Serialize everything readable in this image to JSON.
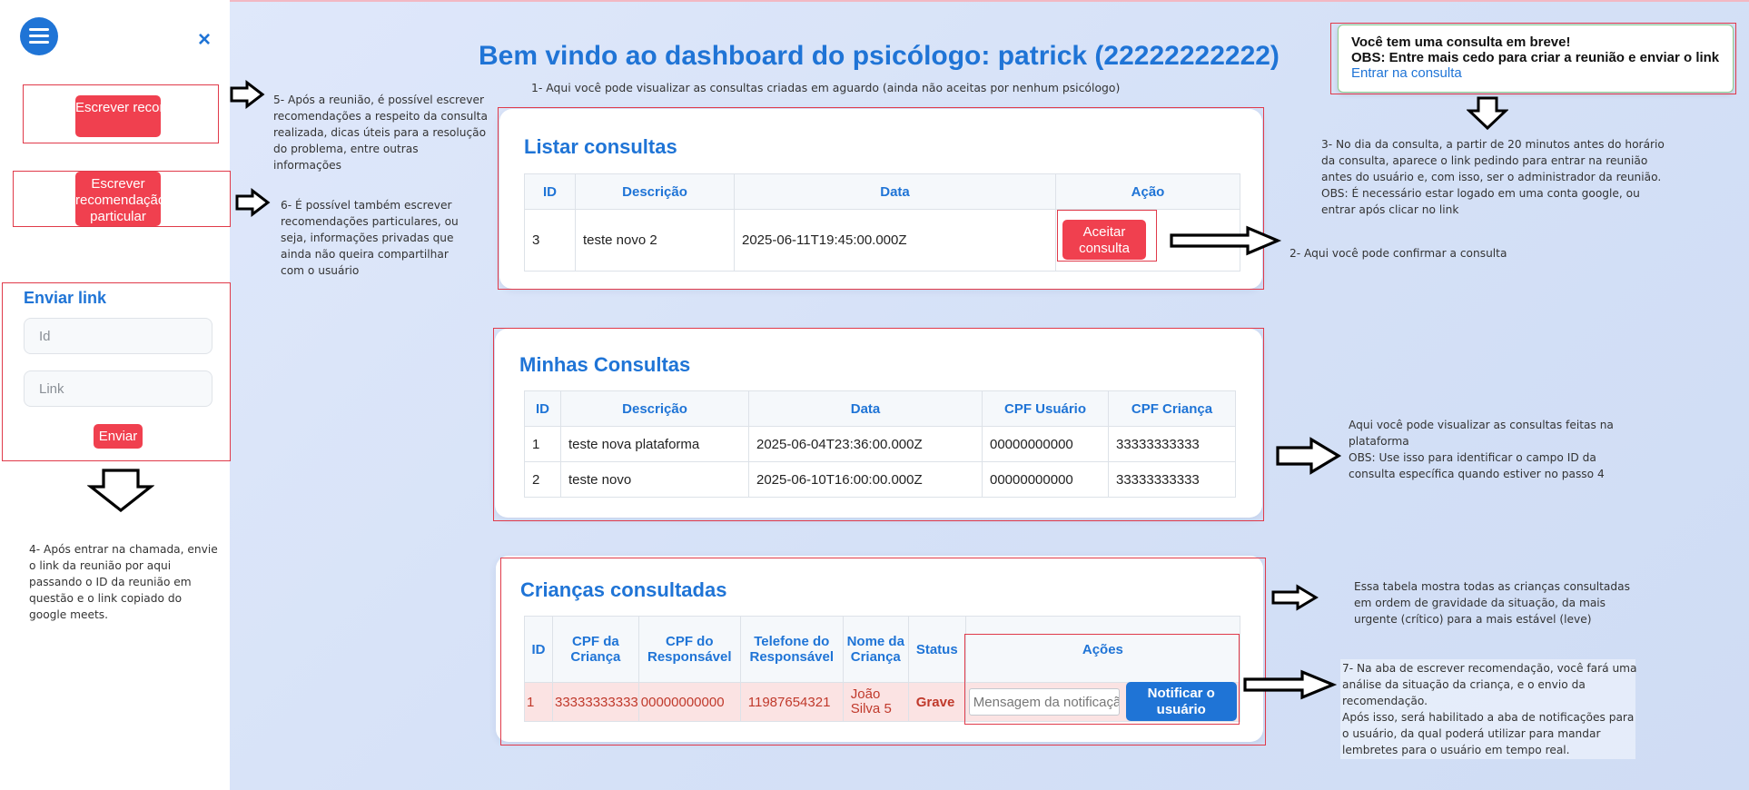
{
  "sidebar": {
    "write_recommendation_label": "Escrever recomendação",
    "write_private_recommendation_label": "Escrever recomendação particular",
    "send_link": {
      "title": "Enviar link",
      "id_placeholder": "Id",
      "link_placeholder": "Link",
      "submit_label": "Enviar"
    }
  },
  "header": {
    "title": "Bem vindo ao dashboard do psicólogo: patrick (22222222222)"
  },
  "notification": {
    "line1": "Você tem uma consulta em breve!",
    "line2": "OBS: Entre mais cedo para criar a reunião e enviar o link",
    "link_label": "Entrar na consulta"
  },
  "annotations": {
    "step1": "1- Aqui você pode visualizar as consultas criadas em aguardo (ainda não aceitas por nenhum psicólogo)",
    "step2": "2- Aqui você pode confirmar a consulta",
    "step3": [
      "3- No dia da consulta, a partir de 20 minutos antes do horário",
      "da consulta, aparece o link pedindo para entrar na reunião",
      "antes do usuário e, com isso, ser o administrador da reunião.",
      "OBS: É necessário estar logado em uma conta google, ou",
      "entrar após clicar no link"
    ],
    "step4": [
      "4- Após entrar na chamada, envie",
      "o link da reunião por aqui",
      "passando o ID da reunião em",
      "questão e o link copiado do",
      "google meets."
    ],
    "step5": [
      "5- Após a reunião, é possível escrever",
      "recomendações a respeito da consulta",
      "realizada, dicas úteis para a resolução",
      "do problema, entre outras",
      "informações"
    ],
    "step6": [
      "6- É possível também escrever",
      "recomendações particulares, ou",
      "seja, informações privadas que",
      "ainda não queira compartilhar",
      "com o usuário"
    ],
    "step7": [
      "7- Na aba de escrever recomendação, você fará uma",
      "análise da situação da criança, e o envio da",
      "recomendação.",
      "Após isso, será habilitado a aba de notificações para",
      "o usuário, da qual poderá utilizar para mandar",
      "lembretes para o usuário em tempo real."
    ],
    "my_consults": [
      "Aqui você pode visualizar as consultas feitas na",
      "plataforma",
      "OBS: Use isso para identificar o campo ID da",
      "consulta específica quando estiver no passo 4"
    ],
    "children": [
      "Essa tabela mostra todas as crianças consultadas",
      "em ordem de gravidade da situação, da mais",
      "urgente (crítico) para a mais estável (leve)"
    ]
  },
  "pending_consults": {
    "title": "Listar consultas",
    "headers": [
      "ID",
      "Descrição",
      "Data",
      "Ação"
    ],
    "rows": [
      {
        "id": "3",
        "description": "teste novo 2",
        "date": "2025-06-11T19:45:00.000Z",
        "action": "Aceitar consulta"
      }
    ]
  },
  "my_consults": {
    "title": "Minhas Consultas",
    "headers": [
      "ID",
      "Descrição",
      "Data",
      "CPF Usuário",
      "CPF Criança"
    ],
    "rows": [
      {
        "id": "1",
        "description": "teste nova plataforma",
        "date": "2025-06-04T23:36:00.000Z",
        "cpf_user": "00000000000",
        "cpf_child": "33333333333"
      },
      {
        "id": "2",
        "description": "teste novo",
        "date": "2025-06-10T16:00:00.000Z",
        "cpf_user": "00000000000",
        "cpf_child": "33333333333"
      }
    ]
  },
  "children": {
    "title": "Crianças consultadas",
    "headers": [
      "ID",
      "CPF da Criança",
      "CPF do Responsável",
      "Telefone do Responsável",
      "Nome da Criança",
      "Status",
      "Ações"
    ],
    "rows": [
      {
        "id": "1",
        "cpf_child": "33333333333",
        "cpf_guardian": "00000000000",
        "phone": "11987654321",
        "name": "João Silva 5",
        "status": "Grave",
        "message_placeholder": "Mensagem da notificação",
        "notify_label": "Notificar o usuário"
      }
    ],
    "row_highlight_color": "#fbe3e3",
    "status_color": "#c0392b"
  },
  "colors": {
    "accent": "#1f74d6",
    "danger_button": "#f0404f",
    "annotation_border": "#e03a4a"
  }
}
